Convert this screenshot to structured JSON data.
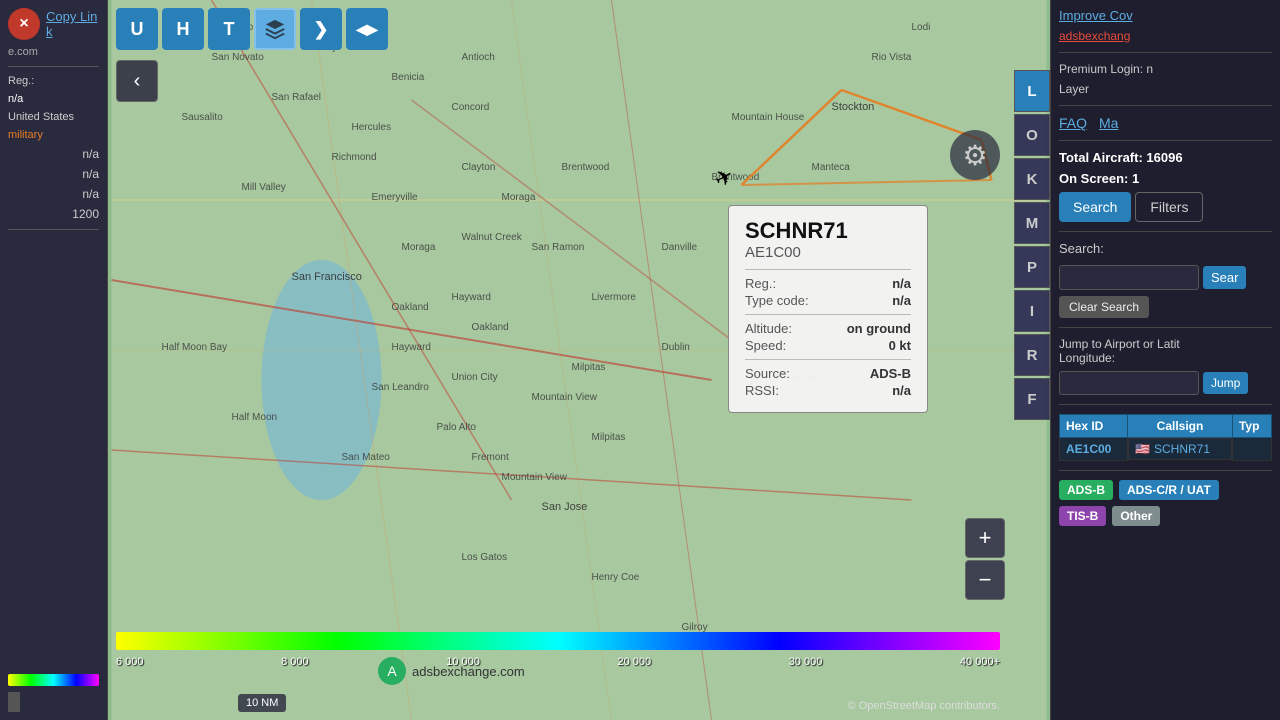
{
  "left_sidebar": {
    "close_label": "×",
    "copy_link_label": "Copy Link",
    "domain": "e.com",
    "stats": {
      "reg_label": "Reg.:",
      "reg_val": "n/a",
      "country_val": "United States",
      "type_val": "military",
      "na1": "n/a",
      "na2": "n/a",
      "na3": "n/a",
      "code_val": "1200"
    }
  },
  "map": {
    "aircraft": {
      "callsign": "SCHNR71",
      "hex_id": "AE1C00",
      "reg": "n/a",
      "type_code": "n/a",
      "altitude": "on ground",
      "speed": "0 kt",
      "source": "ADS-B",
      "rssi": "n/a"
    },
    "popup_labels": {
      "reg": "Reg.:",
      "type_code": "Type code:",
      "altitude": "Altitude:",
      "speed": "Speed:",
      "source": "Source:",
      "rssi": "RSSI:"
    },
    "scale": {
      "label": "10 NM"
    },
    "altitude_labels": [
      "6 000",
      "8 000",
      "10 000",
      "20 000",
      "30 000",
      "40 000+"
    ],
    "attribution": "© OpenStreetMap contributors."
  },
  "top_buttons": {
    "u": "U",
    "h": "H",
    "t": "T",
    "forward": "❯",
    "alt_range": "◀▶"
  },
  "right_btns": [
    "L",
    "O",
    "K",
    "M",
    "P",
    "I",
    "R",
    "F"
  ],
  "right_panel": {
    "improve_cov": "Improve Cov",
    "adsbexchange": "adsbexchang",
    "premium_label": "Premium Login: n",
    "layer_label": "Layer",
    "faq_label": "FAQ",
    "map_label": "Ma",
    "total_label": "Total Aircraft:",
    "total_val": "16096",
    "on_screen_label": "On Screen:",
    "on_screen_val": "1",
    "search_btn": "Search",
    "filters_btn": "Filters",
    "search_section": "Search:",
    "search_placeholder": "",
    "sear_btn": "Sear",
    "clear_search_btn": "Clear Search",
    "jump_section": "Jump to Airport or Latit",
    "longitude_label": "Longitude:",
    "jump_btn": "Jump",
    "table": {
      "headers": [
        "Hex ID",
        "Callsign",
        "Typ"
      ],
      "rows": [
        {
          "hex": "AE1C00",
          "flag": "🇺🇸",
          "callsign": "SCHNR71",
          "type": ""
        }
      ]
    },
    "sources": {
      "adsb": "ADS-B",
      "adsc": "ADS-C/R / UAT",
      "tis": "TIS-B",
      "other": "Other"
    }
  },
  "watermark": {
    "site": "adsbexchange.com"
  },
  "zoom": {
    "plus": "+",
    "minus": "−"
  }
}
